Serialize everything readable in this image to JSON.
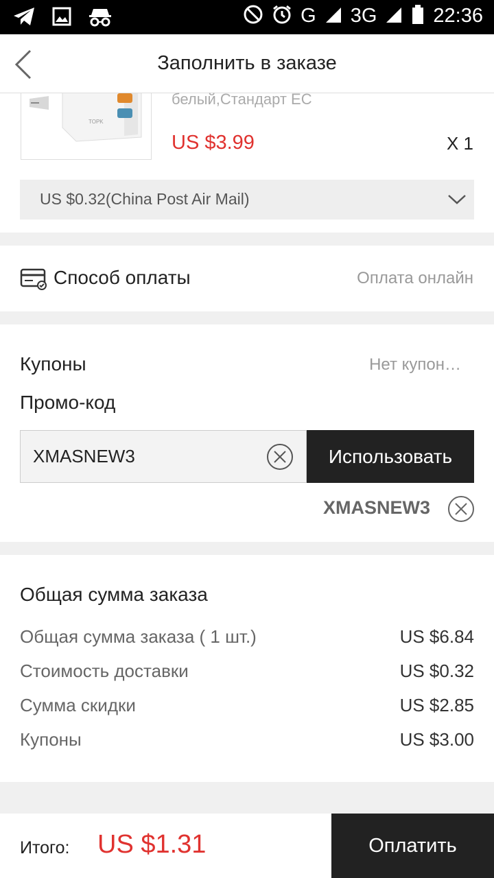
{
  "status_bar": {
    "network_g": "G",
    "network_3g": "3G",
    "time": "22:36",
    "icons": [
      "telegram-icon",
      "image-icon",
      "incognito-icon",
      "do-not-disturb-icon",
      "alarm-icon",
      "signal-icon",
      "battery-icon"
    ]
  },
  "header": {
    "title": "Заполнить в заказе",
    "back_icon": "chevron-left-icon"
  },
  "product": {
    "variant": "белый,Стандарт ЕС",
    "price": "US $3.99",
    "quantity": "X 1",
    "shipping_option": "US $0.32(China Post Air Mail)"
  },
  "payment": {
    "label": "Способ оплаты",
    "value": "Оплата онлайн"
  },
  "coupons": {
    "label": "Купоны",
    "value": "Нет купон…",
    "promo_label": "Промо-код",
    "promo_input_value": "XMASNEW3",
    "apply_label": "Использовать",
    "applied_code": "XMASNEW3"
  },
  "summary": {
    "title": "Общая сумма заказа",
    "rows": [
      {
        "label": "Общая сумма заказа ( 1 шт.)",
        "value": "US $6.84"
      },
      {
        "label": "Стоимость доставки",
        "value": "US $0.32"
      },
      {
        "label": "Сумма скидки",
        "value": "US $2.85"
      },
      {
        "label": "Купоны",
        "value": "US $3.00"
      }
    ]
  },
  "footer": {
    "total_label": "Итого:",
    "total_value": "US $1.31",
    "pay_label": "Оплатить"
  },
  "colors": {
    "accent_red": "#e0322f",
    "dark_button": "#222222"
  }
}
